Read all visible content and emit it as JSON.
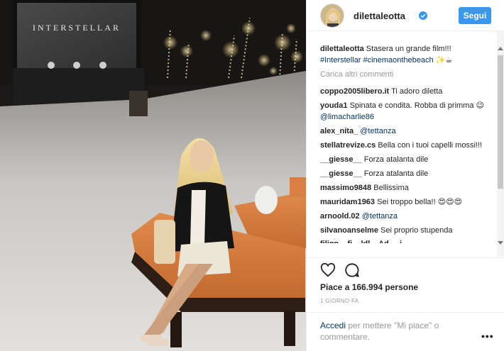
{
  "header": {
    "username": "dilettaleotta",
    "follow_label": "Segui"
  },
  "photo": {
    "screen_text": "INTERSTELLAR"
  },
  "caption": {
    "user": "dilettaleotta",
    "text": "Stasera un grande film!!!",
    "hashtags": "#Interstellar #cinemaonthebeach",
    "emoji": "✨☕"
  },
  "load_more": "Carica altri commenti",
  "comments": [
    {
      "user": "coppo2005libero.it",
      "text": "Ti adoro diletta",
      "mention": ""
    },
    {
      "user": "youda1",
      "text": "Spinata e condita. Robba di primma 😉",
      "mention": "@limacharlie86"
    },
    {
      "user": "alex_nita_",
      "text": "",
      "mention": "@tettanza"
    },
    {
      "user": "stellatrevize.cs",
      "text": "Bella con i tuoi capelli mossi!!!",
      "mention": ""
    },
    {
      "user": "__giesse__",
      "text": "Forza atalanta dile",
      "mention": ""
    },
    {
      "user": "__giesse__",
      "text": "Forza atalanta dile",
      "mention": ""
    },
    {
      "user": "massimo9848",
      "text": "Bellissima",
      "mention": ""
    },
    {
      "user": "mauridam1963",
      "text": "Sei troppo bella!! 😍😍😍",
      "mention": ""
    },
    {
      "user": "arnoold.02",
      "text": "",
      "mention": "@tettanza"
    },
    {
      "user": "silvanoanselme",
      "text": "Sei proprio stupenda",
      "mention": ""
    }
  ],
  "cut_comment": "filipp...  fi... ldl... Ad ... i",
  "likes": "Piace a 166.994 persone",
  "time": "1 GIORNO FA",
  "login": {
    "link": "Accedi",
    "text": " per mettere \"Mi piace\" o commentare."
  },
  "more_label": "•••",
  "colors": {
    "accent": "#3897f0",
    "link": "#003569",
    "muted": "#999999"
  }
}
